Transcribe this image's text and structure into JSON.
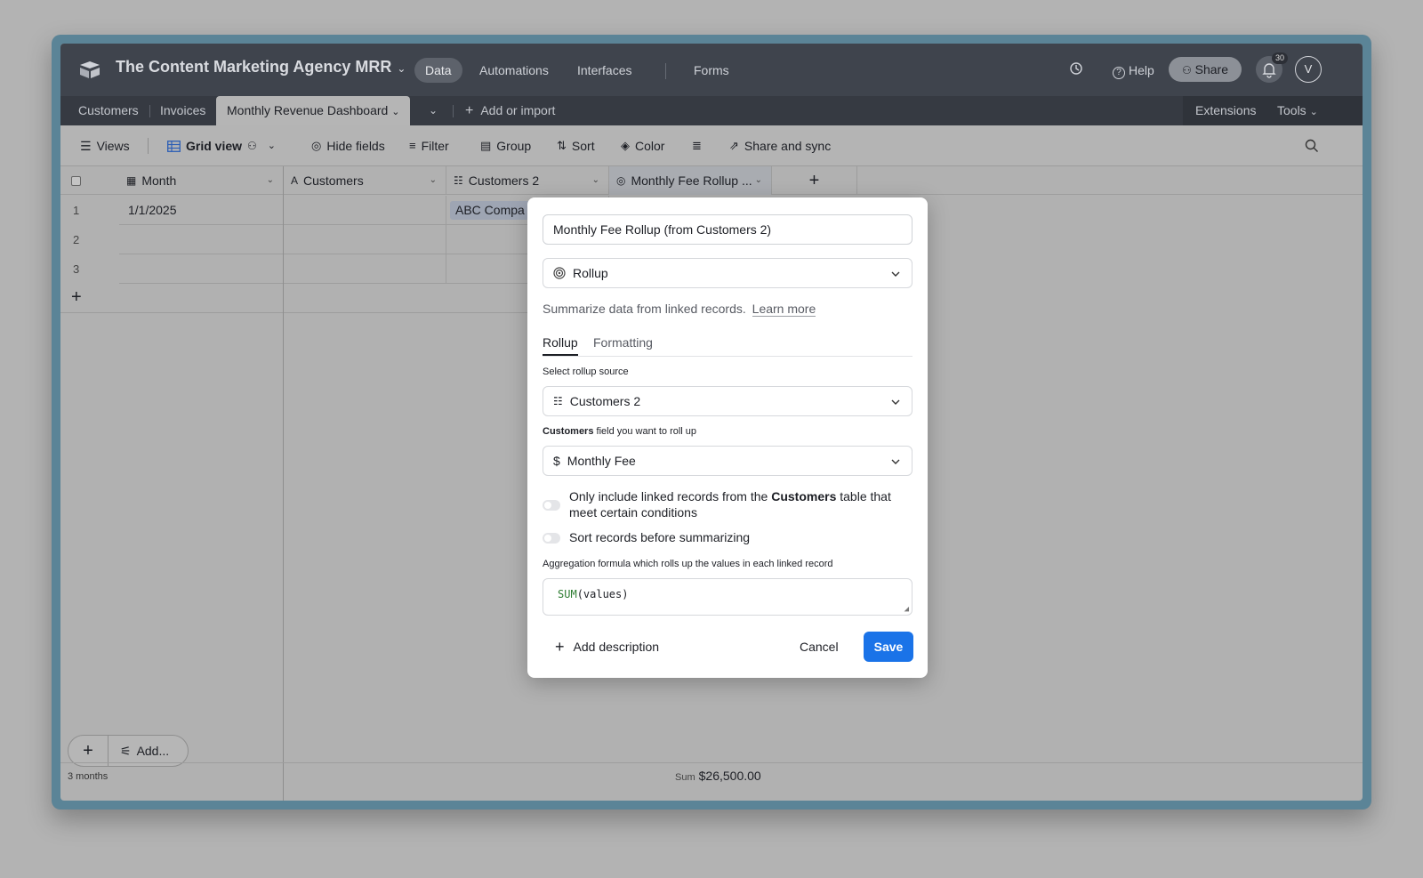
{
  "colors": {
    "accent": "#1a73e8",
    "topbar": "#3f444d",
    "frame": "#5b8497"
  },
  "header": {
    "base_title": "The Content Marketing Agency MRR",
    "nav": [
      "Data",
      "Automations",
      "Interfaces",
      "Forms"
    ],
    "help": "Help",
    "share": "Share",
    "notifications": "30",
    "avatar": "V"
  },
  "tabs": {
    "items": [
      "Customers",
      "Invoices",
      "Monthly Revenue Dashboard"
    ],
    "add": "Add or import",
    "extensions": "Extensions",
    "tools": "Tools"
  },
  "toolbar": {
    "views": "Views",
    "grid_view": "Grid view",
    "hide_fields": "Hide fields",
    "filter": "Filter",
    "group": "Group",
    "sort": "Sort",
    "color": "Color",
    "share_sync": "Share and sync"
  },
  "grid": {
    "columns": [
      "Month",
      "Customers",
      "Customers 2",
      "Monthly Fee Rollup ..."
    ],
    "rows": [
      {
        "num": "1",
        "month": "1/1/2025",
        "customers2": "ABC Compa"
      },
      {
        "num": "2",
        "month": "",
        "customers2": ""
      },
      {
        "num": "3",
        "month": "",
        "customers2": ""
      }
    ],
    "add_label": "Add...",
    "record_count": "3 months",
    "sum_label": "Sum",
    "sum_value": "$26,500.00"
  },
  "modal": {
    "field_name": "Monthly Fee Rollup (from Customers 2)",
    "field_type": "Rollup",
    "description": "Summarize data from linked records.",
    "learn_more": "Learn more",
    "tab_rollup": "Rollup",
    "tab_formatting": "Formatting",
    "source_label": "Select rollup source",
    "source_value": "Customers 2",
    "field_label_bold": "Customers",
    "field_label_rest": "field you want to roll up",
    "field_value": "Monthly Fee",
    "toggle1_a": "Only include linked records from the",
    "toggle1_bold": "Customers",
    "toggle1_b": "table that meet certain conditions",
    "toggle2": "Sort records before summarizing",
    "formula_label": "Aggregation formula which rolls up the values in each linked record",
    "formula_fn": "SUM",
    "formula_args": "(values)",
    "add_description": "Add description",
    "cancel": "Cancel",
    "save": "Save"
  }
}
